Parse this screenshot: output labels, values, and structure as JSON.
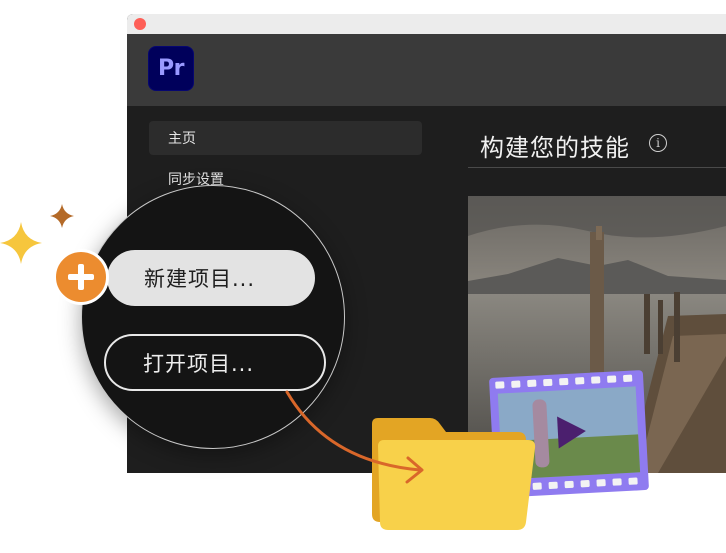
{
  "app": {
    "logo_text": "Pr"
  },
  "sidebar": {
    "items": [
      {
        "label": "主页",
        "active": true
      },
      {
        "label": "同步设置",
        "active": false
      }
    ]
  },
  "main": {
    "section_title": "构建您的技能",
    "info_icon": "info-icon"
  },
  "magnifier": {
    "new_project_label": "新建项目...",
    "open_project_label": "打开项目..."
  },
  "colors": {
    "accent_orange": "#ec8c2f",
    "premiere_blue": "#00005b",
    "premiere_text": "#9999ff",
    "folder_yellow": "#f6c63d",
    "film_purple": "#8f7bf0"
  }
}
